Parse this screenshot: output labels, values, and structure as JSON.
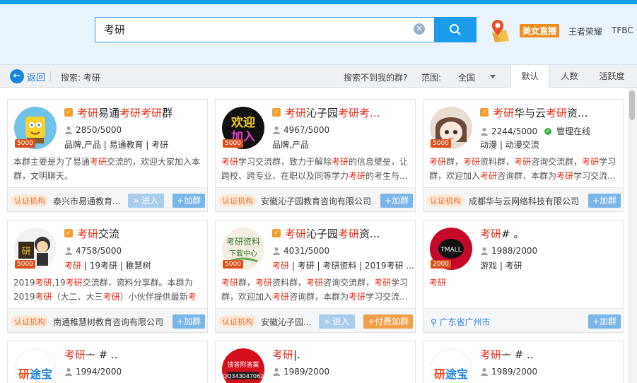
{
  "search": {
    "query": "考研",
    "clear_icon": "close-circle-icon",
    "button_icon": "search-icon"
  },
  "hot": {
    "tag": "美女直播",
    "links": [
      "王者荣耀",
      "TFBC"
    ]
  },
  "subbar": {
    "back_label": "返回",
    "search_term": "搜索: 考研",
    "not_found": "搜索不到我的群?",
    "range_label": "范围:",
    "region": "全国",
    "sort_tabs": [
      "默认",
      "人数",
      "活跃度"
    ]
  },
  "cards": [
    {
      "name_parts": [
        "考研",
        "易通",
        "考研",
        "考研",
        "群"
      ],
      "level": "5000",
      "members": "2850/5000",
      "tags": "品牌,产品  |  易通教育  |  考研",
      "desc_parts": [
        "本群主要是为了易通",
        "考研",
        "交流的，欢迎大家加入本群，文明聊天。"
      ],
      "org_badge": "认证机构",
      "org": "泰兴市易通教育...",
      "enter": "» 进入",
      "join": "+加群"
    },
    {
      "name_parts": [
        "考研",
        "沁子园",
        "考研",
        "考...",
        ""
      ],
      "level": "5000",
      "members": "4967/5000",
      "tags": "品牌,产品",
      "desc_parts": [
        "考研",
        "学习交流群，致力于解除",
        "考研",
        "的信息壁垒，让跨校、跨专业、在职以及同等学力",
        "考研",
        "的考生与..."
      ],
      "org_badge": "认证机构",
      "org": "安徽沁子园教育咨询有限公司",
      "join": "+加群"
    },
    {
      "name_parts": [
        "考研",
        "华与云",
        "考研",
        "资...",
        ""
      ],
      "level": "5000",
      "members": "2244/5000",
      "admin": "管理在线",
      "tags": "动漫  |  动漫交流",
      "desc_parts": [
        "考研",
        "群，",
        "考研",
        "资料群，",
        "考研",
        "咨询交流群，",
        "考研",
        "学习群，欢迎加入",
        "考研",
        "咨询群，本群为",
        "考研",
        "学习交流..."
      ],
      "org_badge": "认证机构",
      "org": "成都华与云网络科技有限公司",
      "join": "+加群"
    },
    {
      "name_parts": [
        "考研",
        "交流",
        "",
        "",
        ""
      ],
      "level": "5000",
      "members": "4758/5000",
      "tags_parts": [
        "考研",
        "  |  19考研  |  稚慧树"
      ],
      "desc_parts": [
        "2019",
        "考研",
        ",19",
        "考研",
        "交流群，资料分享群。本群为2019",
        "考研",
        "（大二、大三",
        "考研",
        "）小伙伴提供最新",
        "考研",
        ""
      ],
      "org_badge": "认证机构",
      "org": "南通稚慧树教育咨询有限公司",
      "join": "+加群"
    },
    {
      "name_parts": [
        "考研",
        "沁子园",
        "考研",
        "资...",
        ""
      ],
      "level": "5000",
      "members": "4031/5000",
      "tags_parts": [
        "考研",
        "  |  考研  |  考研资料  |  2019考研 ..."
      ],
      "desc_parts": [
        "考研",
        "群，",
        "考研",
        "资料群，",
        "考研",
        "咨询交流群，",
        "考研",
        "学习群，欢迎加入",
        "考研",
        "咨询群，本群为",
        "考研",
        "学习交流..."
      ],
      "org_badge": "认证机构",
      "org": "安徽沁子园...",
      "enter": "» 进入",
      "paid": "+付费加群"
    },
    {
      "name_parts": [
        "考研",
        "# 。",
        "",
        "",
        ""
      ],
      "level": "2000",
      "members": "1988/2000",
      "tags": "游戏  |  考研",
      "desc_parts": [
        "考研"
      ],
      "location": "广东省广州市",
      "join": "+加群"
    },
    {
      "name_parts": [
        "考研",
        "ᅩ # ..",
        "",
        "",
        ""
      ],
      "members": "1994/2000"
    },
    {
      "name_parts": [
        "考研",
        "|.",
        "",
        "",
        ""
      ],
      "members": "1989/2000"
    },
    {
      "name_parts": [
        "考研",
        "ᅩ # ..",
        "",
        "",
        ""
      ],
      "members": "1989/2000"
    }
  ],
  "colors": {
    "accent": "#12a0e8",
    "highlight": "#e0301e",
    "orange": "#f08c20"
  }
}
